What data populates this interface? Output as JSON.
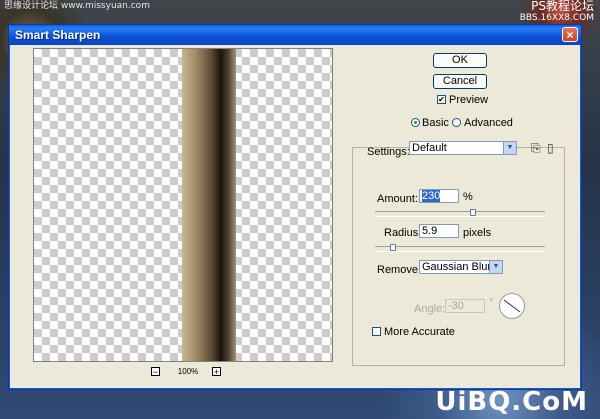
{
  "watermarks": {
    "top_left": "思缘设计论坛 www.missyuan.com",
    "top_right_line1": "PS教程论坛",
    "top_right_line2": "BBS.16XX8.COM",
    "bottom_right": "UiBQ.CoM"
  },
  "window": {
    "title": "Smart Sharpen",
    "close_symbol": "×"
  },
  "preview": {
    "zoom_level": "100%",
    "zoom_out_symbol": "−",
    "zoom_in_symbol": "+"
  },
  "buttons": {
    "ok": "OK",
    "cancel": "Cancel"
  },
  "preview_toggle": {
    "label": "Preview",
    "checked": true,
    "check_symbol": "✔"
  },
  "mode": {
    "basic": "Basic",
    "advanced": "Advanced",
    "selected": "Basic"
  },
  "settings": {
    "label": "Settings:",
    "value": "Default",
    "save_icon": "save-icon",
    "delete_icon": "trash-icon"
  },
  "amount": {
    "label": "Amount:",
    "value": "230",
    "unit": "%",
    "slider_fraction": 0.58
  },
  "radius": {
    "label": "Radius:",
    "value": "5.9",
    "unit": "pixels",
    "slider_fraction": 0.09
  },
  "remove": {
    "label": "Remove:",
    "value": "Gaussian Blur"
  },
  "angle": {
    "label": "Angle:",
    "value": "-30",
    "unit": "°"
  },
  "more_accurate": {
    "label": "More Accurate",
    "checked": false
  },
  "colors": {
    "titlebar": "#0a52d8",
    "dialog_bg": "#ece9d8",
    "accent": "#316ac5"
  }
}
